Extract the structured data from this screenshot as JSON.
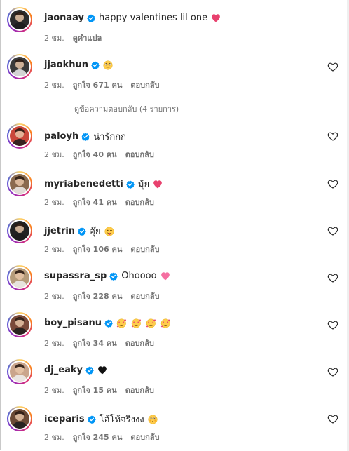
{
  "comments": [
    {
      "username": "jaonaay",
      "text": "happy valentines lil one",
      "emoji": "heart-sparkle",
      "time": "2 ชม.",
      "likes": "",
      "action": "ดูคำแปล",
      "liked_icon": false,
      "avatar_color": "#2b2b2b"
    },
    {
      "username": "jjaokhun",
      "text": "",
      "emoji": "face-rolling-eyes",
      "time": "2 ชม.",
      "likes": "ถูกใจ 671 คน",
      "action": "ตอบกลับ",
      "liked_icon": true,
      "avatar_color": "#3a3a3a"
    },
    {
      "username": "paloyh",
      "text": "น่ารักกก",
      "emoji": "",
      "time": "2 ชม.",
      "likes": "ถูกใจ 40 คน",
      "action": "ตอบกลับ",
      "liked_icon": true,
      "avatar_color": "#c9473a"
    },
    {
      "username": "myriabenedetti",
      "text": "มุ้ย",
      "emoji": "heart-sparkle",
      "time": "2 ชม.",
      "likes": "ถูกใจ 41 คน",
      "action": "ตอบกลับ",
      "liked_icon": true,
      "avatar_color": "#8a6a4e"
    },
    {
      "username": "jjetrin",
      "text": "อุ๊ย",
      "emoji": "face-tongue",
      "time": "2 ชม.",
      "likes": "ถูกใจ 106 คน",
      "action": "ตอบกลับ",
      "liked_icon": true,
      "avatar_color": "#222222"
    },
    {
      "username": "supassra_sp",
      "text": "Ohoooo",
      "emoji": "heart-pink",
      "time": "2 ชม.",
      "likes": "ถูกใจ 228 คน",
      "action": "ตอบกลับ",
      "liked_icon": true,
      "avatar_color": "#b59b7a"
    },
    {
      "username": "boy_pisanu",
      "text": "",
      "emoji": "face-hearts-x4",
      "time": "2 ชม.",
      "likes": "ถูกใจ 34 คน",
      "action": "ตอบกลับ",
      "liked_icon": true,
      "avatar_color": "#7a4a3a"
    },
    {
      "username": "dj_eaky",
      "text": "",
      "emoji": "heart-black",
      "time": "2 ชม.",
      "likes": "ถูกใจ 15 คน",
      "action": "ตอบกลับ",
      "liked_icon": true,
      "avatar_color": "#caa58c"
    },
    {
      "username": "iceparis",
      "text": "โอ้โห้จริงงง",
      "emoji": "face-flushed",
      "time": "2 ชม.",
      "likes": "ถูกใจ 245 คน",
      "action": "ตอบกลับ",
      "liked_icon": true,
      "avatar_color": "#6b4a35"
    }
  ],
  "replies_toggle": "ดูข้อความตอบกลับ (4 รายการ)",
  "colors": {
    "verified": "#0095f6",
    "secondary_text": "#737373",
    "primary_text": "#262626"
  }
}
